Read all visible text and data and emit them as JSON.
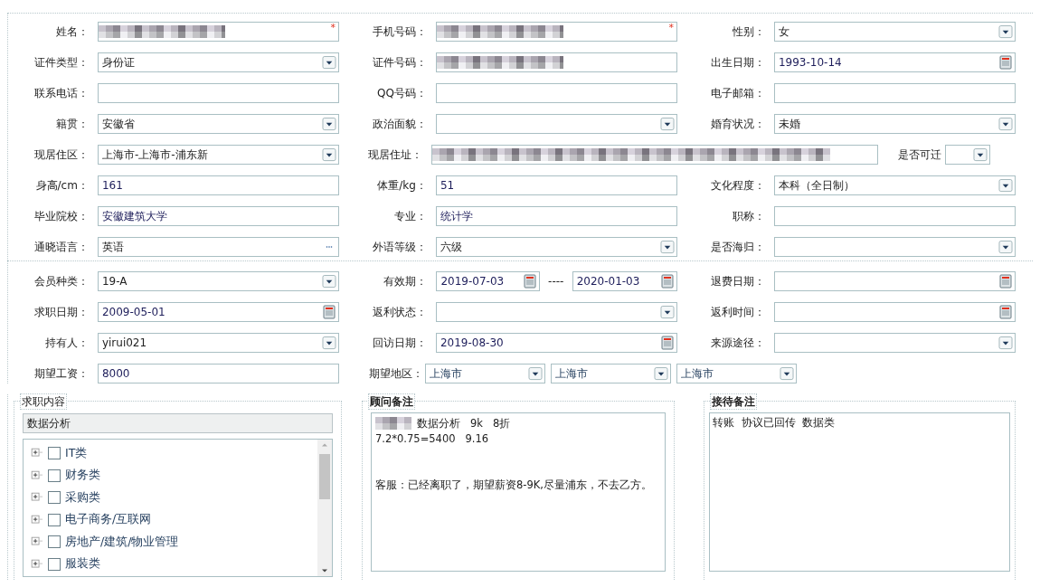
{
  "basic_info": {
    "rows": [
      [
        {
          "label": "姓名：",
          "kind": "redacted",
          "required_mark": "*"
        },
        {
          "label": "手机号码：",
          "kind": "redacted",
          "required_mark": "*"
        },
        {
          "label": "性别：",
          "kind": "select",
          "value": "女"
        }
      ],
      [
        {
          "label": "证件类型：",
          "kind": "select",
          "value": "身份证"
        },
        {
          "label": "证件号码：",
          "kind": "redacted"
        },
        {
          "label": "出生日期：",
          "kind": "date",
          "value": "1993-10-14"
        }
      ],
      [
        {
          "label": "联系电话：",
          "kind": "text"
        },
        {
          "label": "QQ号码：",
          "kind": "text"
        },
        {
          "label": "电子邮箱：",
          "kind": "text"
        }
      ],
      [
        {
          "label": "籍贯：",
          "kind": "select",
          "value": "安徽省"
        },
        {
          "label": "政治面貌：",
          "kind": "select"
        },
        {
          "label": "婚育状况：",
          "kind": "select",
          "value": "未婚"
        }
      ],
      [
        {
          "label": "现居住区：",
          "kind": "select",
          "value": "上海市-上海市-浦东新"
        },
        {
          "label": "现居住址：",
          "kind": "redacted-wide"
        },
        {
          "label": "是否可迁",
          "kind": "select-small"
        }
      ],
      [
        {
          "label": "身高/cm：",
          "kind": "text",
          "value": "161"
        },
        {
          "label": "体重/kg：",
          "kind": "text",
          "value": "51"
        },
        {
          "label": "文化程度：",
          "kind": "select",
          "value": "本科（全日制）"
        }
      ],
      [
        {
          "label": "毕业院校：",
          "kind": "text",
          "value": "安徽建筑大学"
        },
        {
          "label": "专业：",
          "kind": "text",
          "value": "统计学"
        },
        {
          "label": "职称：",
          "kind": "text"
        }
      ],
      [
        {
          "label": "通晓语言：",
          "kind": "lookup",
          "value": "英语"
        },
        {
          "label": "外语等级：",
          "kind": "select",
          "value": "六级"
        },
        {
          "label": "是否海归：",
          "kind": "select"
        }
      ]
    ]
  },
  "membership": {
    "rows": [
      [
        {
          "label": "会员种类：",
          "kind": "select",
          "value": "19-A"
        },
        {
          "label": "有效期：",
          "kind": "date-range",
          "values": [
            "2019-07-03",
            "2020-01-03"
          ],
          "separator": "----"
        },
        {
          "label": "退费日期：",
          "kind": "date"
        }
      ],
      [
        {
          "label": "求职日期：",
          "kind": "date",
          "value": "2009-05-01"
        },
        {
          "label": "返利状态：",
          "kind": "select"
        },
        {
          "label": "返利时间：",
          "kind": "date"
        }
      ],
      [
        {
          "label": "持有人：",
          "kind": "select",
          "value": "yirui021"
        },
        {
          "label": "回访日期：",
          "kind": "date",
          "value": "2019-08-30"
        },
        {
          "label": "来源途径：",
          "kind": "select"
        }
      ],
      [
        {
          "label": "期望工资：",
          "kind": "text",
          "value": "8000"
        },
        {
          "label": "期望地区：",
          "kind": "multi-select",
          "values": [
            "上海市",
            "上海市",
            "上海市"
          ]
        }
      ]
    ]
  },
  "job_content": {
    "title": "求职内容",
    "selected_text": "数据分析",
    "tree": [
      {
        "label": "IT类",
        "checked": false,
        "expanded": false
      },
      {
        "label": "财务类",
        "checked": false,
        "expanded": false
      },
      {
        "label": "采购类",
        "checked": false,
        "expanded": false
      },
      {
        "label": "电子商务/互联网",
        "checked": false,
        "expanded": false
      },
      {
        "label": "房地产/建筑/物业管理",
        "checked": false,
        "expanded": false
      },
      {
        "label": "服装类",
        "checked": false,
        "expanded": false
      }
    ]
  },
  "consultant_notes": {
    "title": "顾问备注",
    "paragraphs": [
      {
        "text": "数据分析   9k   8折",
        "redacted_prefix": true
      },
      {
        "text": "7.2*0.75=5400   9.16"
      },
      {
        "text": "客服：已经离职了，期望薪资8-9K,尽量浦东，不去乙方。",
        "gap_before": true
      }
    ]
  },
  "reception_notes": {
    "title": "接待备注",
    "text": "转账  协议已回传  数据类"
  }
}
